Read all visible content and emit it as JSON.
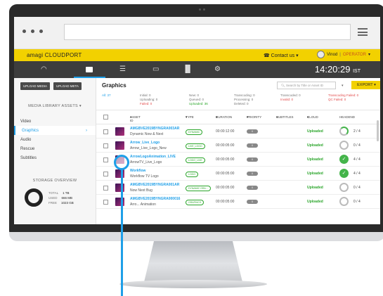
{
  "brand": "amagi CLOUDPORT",
  "topbar": {
    "contact": "Contact us",
    "user": "Vinod",
    "role": "OPERATOR"
  },
  "clock": {
    "time": "14:20:29",
    "tz": "IST"
  },
  "sidebar": {
    "buttons": [
      "UPLOAD MEDIA",
      "UPLOAD META"
    ],
    "library_label": "MEDIA LIBRARY ASSETS",
    "items": [
      "Video",
      "Graphics",
      "Audio",
      "Rescue",
      "Subtitles"
    ],
    "active_item": "Graphics",
    "storage_label": "STORAGE OVERVIEW",
    "storage": [
      {
        "label": "TOTAL",
        "value": "1 TB"
      },
      {
        "label": "USED",
        "value": "666 MB"
      },
      {
        "label": "FREE",
        "value": "1023 GB"
      }
    ]
  },
  "main": {
    "title": "Graphics",
    "search_placeholder": "Search by Title or Asset ID",
    "export_label": "EXPORT"
  },
  "summary": {
    "all": "All: 37",
    "initial": "Initial: 0",
    "uploading": "Uploading: 0",
    "failed": "Failed: 0",
    "new": "New: 0",
    "queued": "Queued: 0",
    "uploaded": "Uploaded: 36",
    "transcoding": "Transcoding: 0",
    "processing": "Processing: 0",
    "deleted": "Deleted: 0",
    "transcoded": "Transcoded: 0",
    "invalid": "Invalid: 0",
    "tfailed": "Transcoding Failed: 0",
    "qcfailed": "QC Failed: 0"
  },
  "table": {
    "headers": [
      "ASSET ID",
      "TYPE",
      "DURATION",
      "PRIORITY",
      "SUBTITLES",
      "CLOUD",
      "HEADEND"
    ],
    "rows": [
      {
        "id": "AMGBVE2019BYNGRA003AR",
        "title": "Dynamic Now & Next",
        "type": "DYNAMIC",
        "duration": "00:00:12:00",
        "priority": "0",
        "cloud": "Uploaded",
        "headend": "2 / 4",
        "state": "part"
      },
      {
        "id": "Arrow_Live_Logo",
        "title": "Arrow_Live_Logo_New",
        "type": "LIVE_LOGO",
        "duration": "00:00:05:00",
        "priority": "0",
        "cloud": "Uploaded",
        "headend": "0 / 4",
        "state": "none"
      },
      {
        "id": "ArrowLogoAnimation_LIVE",
        "title": "ArrowTV_Live_Logo",
        "type": "LOGO_LIVE",
        "duration": "00:00:05:00",
        "priority": "0",
        "cloud": "Uploaded",
        "headend": "4 / 4",
        "state": "done"
      },
      {
        "id": "Workflow",
        "title": "Workflow TV Logo",
        "type": "LOGO",
        "duration": "00:00:05:00",
        "priority": "0",
        "cloud": "Uploaded",
        "headend": "4 / 4",
        "state": "done"
      },
      {
        "id": "AMGBVE2019BYNGRA001AR",
        "title": "Now Next Bug",
        "type": "DYNAMIC GRA...",
        "duration": "00:00:05:00",
        "priority": "0",
        "cloud": "Uploaded",
        "headend": "0 / 4",
        "state": "none"
      },
      {
        "id": "AMGBVE2019BYNGRA000016",
        "title": "Arro... Animation",
        "type": "GRAPHICS",
        "duration": "00:00:05:00",
        "priority": "0",
        "cloud": "Uploaded",
        "headend": "0 / 4",
        "state": "none"
      }
    ]
  }
}
